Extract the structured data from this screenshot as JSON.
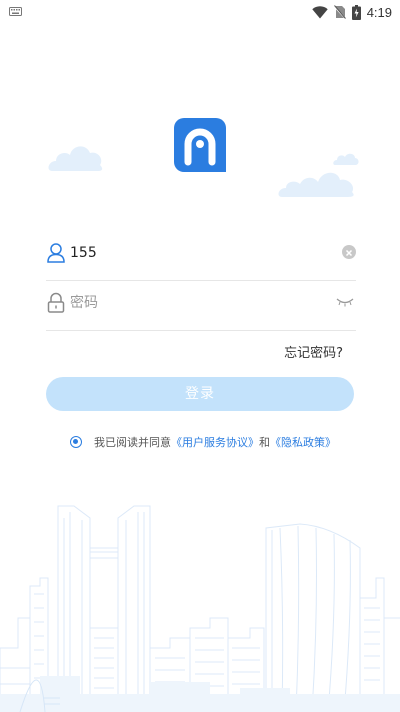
{
  "status_bar": {
    "time": "4:19",
    "icons": [
      "keyboard-icon",
      "wifi-icon",
      "no-sim-icon",
      "battery-charging-icon"
    ]
  },
  "app": {
    "logo_icon": "app-logo-icon",
    "brand_color": "#2b7de0"
  },
  "login": {
    "phone_value": "155",
    "phone_icon": "user-icon",
    "password_placeholder": "密码",
    "password_icon": "lock-icon",
    "forgot_label": "忘记密码?",
    "submit_label": "登录"
  },
  "agreement": {
    "checked": true,
    "prefix": "我已阅读并同意",
    "terms_link": "《用户服务协议》",
    "conjunction": "和",
    "privacy_link": "《隐私政策》"
  },
  "colors": {
    "accent": "#2b7de0",
    "button_disabled": "#c3e2fb",
    "cloud": "#e3effb"
  }
}
